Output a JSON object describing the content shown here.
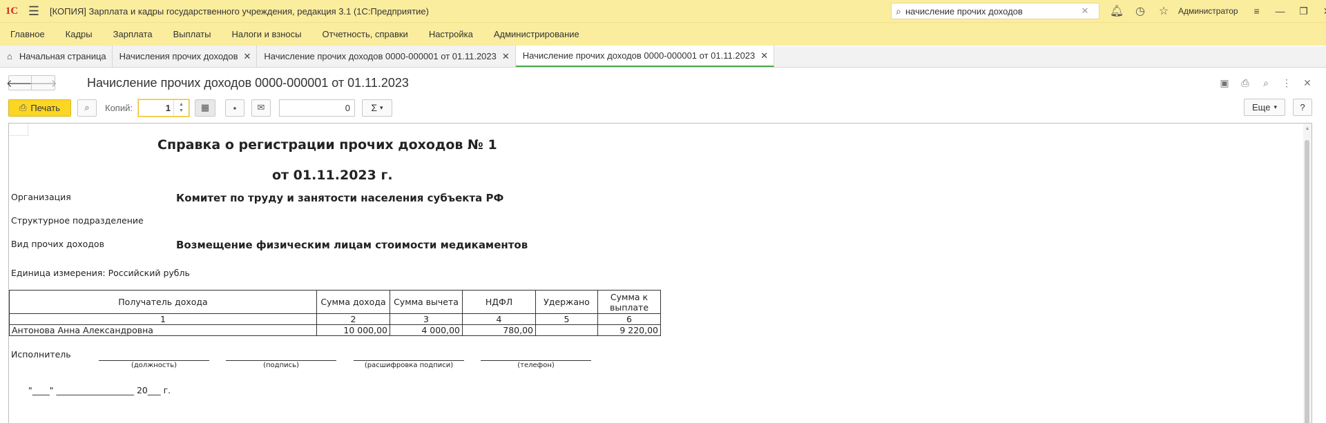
{
  "titlebar": {
    "logo": "1С",
    "title": "[КОПИЯ] Зарплата и кадры государственного учреждения, редакция 3.1  (1С:Предприятие)",
    "search_value": "начисление прочих доходов",
    "user": "Администратор"
  },
  "menu": [
    "Главное",
    "Кадры",
    "Зарплата",
    "Выплаты",
    "Налоги и взносы",
    "Отчетность, справки",
    "Настройка",
    "Администрирование"
  ],
  "tabs": [
    {
      "label": "Начальная страница"
    },
    {
      "label": "Начисления прочих доходов"
    },
    {
      "label": "Начисление прочих доходов 0000-000001 от 01.11.2023"
    },
    {
      "label": "Начисление прочих доходов 0000-000001 от 01.11.2023"
    }
  ],
  "form": {
    "title": "Начисление прочих доходов 0000-000001 от 01.11.2023"
  },
  "toolbar": {
    "print_label": "Печать",
    "copies_label": "Копий:",
    "copies_value": "1",
    "sum_value": "0",
    "sum_symbol": "Σ",
    "more_label": "Еще",
    "help_label": "?"
  },
  "report": {
    "title": "Справка о регистрации прочих доходов № 1",
    "date": "от 01.11.2023 г.",
    "org_label": "Организация",
    "org_value": "Комитет по труду и занятости населения субъекта РФ",
    "dept_label": "Структурное подразделение",
    "income_label": "Вид прочих доходов",
    "income_value": "Возмещение физическим лицам стоимости медикаментов",
    "unit": "Единица измерения: Российский рубль",
    "table": {
      "headers": [
        "Получатель дохода",
        "Сумма дохода",
        "Сумма вычета",
        "НДФЛ",
        "Удержано",
        "Сумма к выплате"
      ],
      "numbers": [
        "1",
        "2",
        "3",
        "4",
        "5",
        "6"
      ],
      "rows": [
        {
          "recipient": "Антонова Анна Александровна",
          "income": "10 000,00",
          "deduction": "4 000,00",
          "ndfl": "780,00",
          "withheld": "",
          "payout": "9 220,00"
        }
      ]
    },
    "executor_label": "Исполнитель",
    "sig_captions": [
      "(должность)",
      "(подпись)",
      "(расшифровка подписи)",
      "(телефон)"
    ],
    "date_line": "\"____\" __________________ 20___ г."
  }
}
